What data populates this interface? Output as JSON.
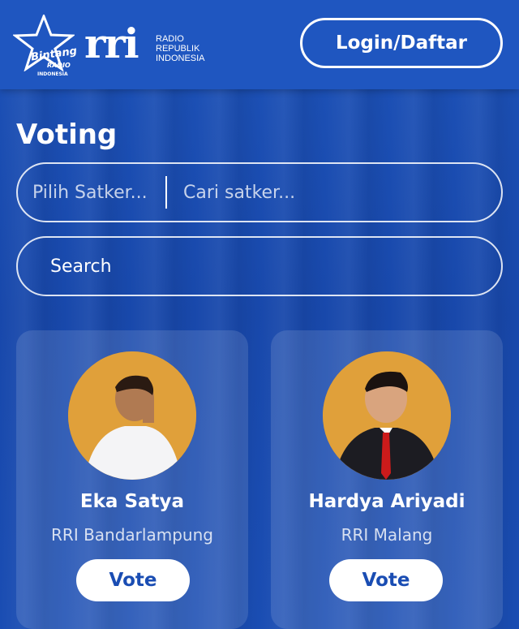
{
  "header": {
    "star_logo_line1": "Bintang",
    "star_logo_line2": "RADIO",
    "star_logo_line3": "INDONESIA",
    "rri_logo_text": "rri",
    "rri_sub_line1": "RADIO",
    "rri_sub_line2": "REPUBLIK",
    "rri_sub_line3": "INDONESIA",
    "login_label": "Login/Daftar"
  },
  "main": {
    "title": "Voting",
    "satker_select_placeholder": "Pilih Satker...",
    "satker_search_placeholder": "Cari satker...",
    "search_label": "Search"
  },
  "candidates": [
    {
      "name": "Eka Satya",
      "station": "RRI Bandarlampung",
      "vote_label": "Vote"
    },
    {
      "name": "Hardya Ariyadi",
      "station": "RRI Malang",
      "vote_label": "Vote"
    }
  ],
  "colors": {
    "background": "#1a4db3",
    "header": "#1f56c0",
    "accent_text": "#1a4db3",
    "avatar_bg": "#e09a30"
  },
  "icons": [
    "bintang-radio-star-logo",
    "rri-logo"
  ]
}
